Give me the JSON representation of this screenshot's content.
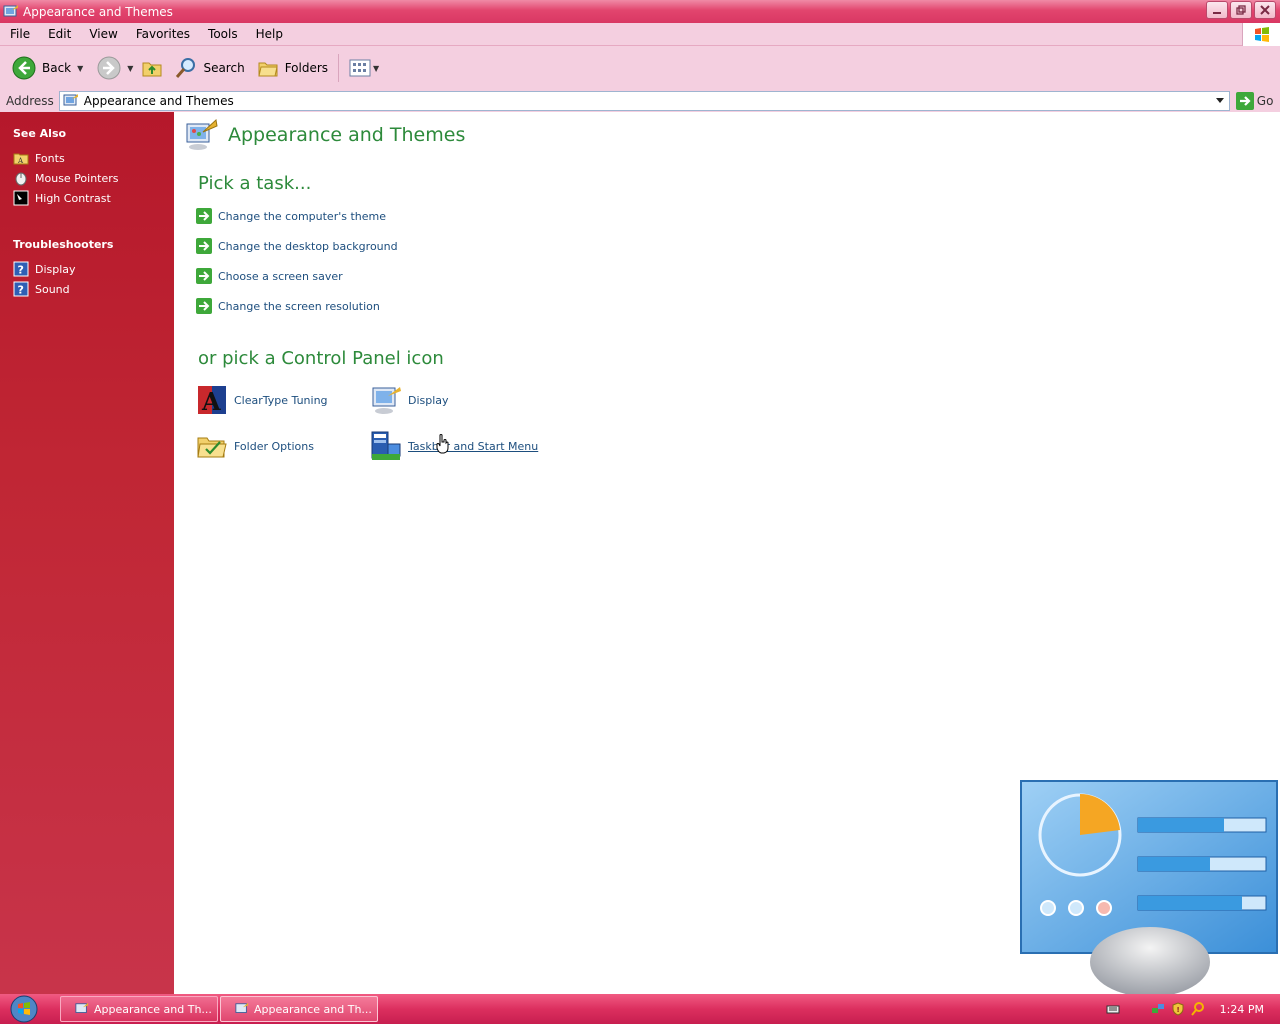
{
  "window": {
    "title": "Appearance and Themes"
  },
  "menu": [
    "File",
    "Edit",
    "View",
    "Favorites",
    "Tools",
    "Help"
  ],
  "toolbar": {
    "back_label": "Back",
    "search_label": "Search",
    "folders_label": "Folders"
  },
  "address": {
    "label": "Address",
    "value": "Appearance and Themes",
    "go_label": "Go"
  },
  "sidebar": {
    "see_also": {
      "title": "See Also",
      "items": [
        {
          "label": "Fonts",
          "icon": "fonts-folder-icon"
        },
        {
          "label": "Mouse Pointers",
          "icon": "mouse-pointer-icon"
        },
        {
          "label": "High Contrast",
          "icon": "high-contrast-icon"
        }
      ]
    },
    "troubleshooters": {
      "title": "Troubleshooters",
      "items": [
        {
          "label": "Display",
          "icon": "help-icon"
        },
        {
          "label": "Sound",
          "icon": "help-icon"
        }
      ]
    }
  },
  "main": {
    "title": "Appearance and Themes",
    "pick_task_heading": "Pick a task...",
    "tasks": [
      "Change the computer's theme",
      "Change the desktop background",
      "Choose a screen saver",
      "Change the screen resolution"
    ],
    "pick_icon_heading": "or pick a Control Panel icon",
    "icons": [
      {
        "label": "ClearType Tuning",
        "icon": "cleartype-icon"
      },
      {
        "label": "Display",
        "icon": "display-icon"
      },
      {
        "label": "Folder Options",
        "icon": "folder-options-icon"
      },
      {
        "label": "Taskbar and Start Menu",
        "icon": "taskbar-icon"
      }
    ]
  },
  "taskbar": {
    "buttons": [
      "Appearance and Th...",
      "Appearance and Th..."
    ],
    "clock": "1:24 PM"
  },
  "colors": {
    "title_bar": "#e2456e",
    "side_panel": "#b5182b",
    "heading_green": "#2d8a3b",
    "link_blue": "#1d4e7e"
  }
}
